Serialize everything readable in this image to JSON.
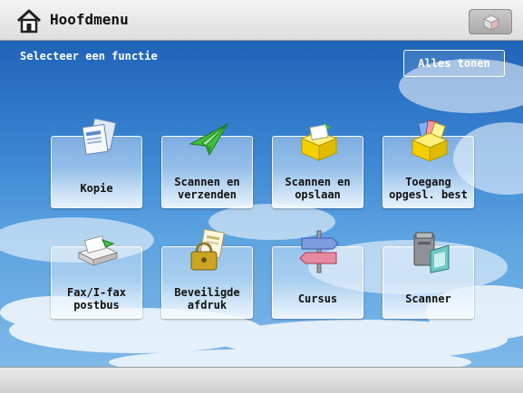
{
  "header": {
    "title": "Hoofdmenu"
  },
  "main": {
    "instruction": "Selecteer een functie",
    "show_all_label": "Alles tonen",
    "tiles": [
      {
        "label": "Kopie",
        "icon": "copy-icon"
      },
      {
        "label": "Scannen en\nverzenden",
        "icon": "send-icon"
      },
      {
        "label": "Scannen en\nopslaan",
        "icon": "store-icon"
      },
      {
        "label": "Toegang\nopgesl. best",
        "icon": "access-files-icon"
      },
      {
        "label": "Fax/I-fax\npostbus",
        "icon": "fax-inbox-icon"
      },
      {
        "label": "Beveiligde\nafdruk",
        "icon": "secure-print-icon"
      },
      {
        "label": "Cursus",
        "icon": "signpost-icon"
      },
      {
        "label": "Scanner",
        "icon": "scanner-icon"
      }
    ]
  },
  "colors": {
    "sky_top": "#1f63b8",
    "sky_bottom": "#7fb8e8",
    "header_bg": "#e8e8e8"
  }
}
